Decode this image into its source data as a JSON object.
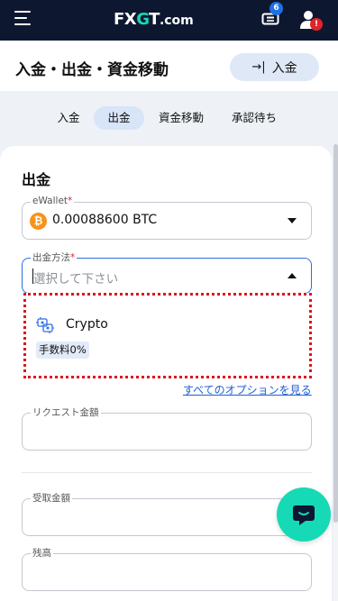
{
  "header": {
    "logo_text_a": "FX",
    "logo_text_g": "G",
    "logo_text_t": "T",
    "logo_text_dom": ".com",
    "promo_badge": "6",
    "user_badge": "!"
  },
  "page": {
    "title": "入金・出金・資金移動",
    "deposit_button": "入金",
    "deposit_icon": "login-arrow-icon"
  },
  "tabs": [
    {
      "label": "入金",
      "active": false
    },
    {
      "label": "出金",
      "active": true
    },
    {
      "label": "資金移動",
      "active": false
    },
    {
      "label": "承認待ち",
      "active": false
    }
  ],
  "form": {
    "section_title": "出金",
    "ewallet": {
      "label": "eWallet",
      "required_mark": "*",
      "value": "0.00088600 BTC",
      "currency_icon": "bitcoin-icon"
    },
    "method": {
      "label": "出金方法",
      "required_mark": "*",
      "placeholder": "選択して下さい"
    },
    "method_options": [
      {
        "label": "Crypto",
        "fee": "手数料0%",
        "icon": "crypto-icon"
      }
    ],
    "all_options_link": "すべてのオプションを見る",
    "request_amount_label": "リクエスト金額",
    "received_amount_label": "受取金額",
    "balance_label": "残高"
  },
  "colors": {
    "nav_bg": "#0d1830",
    "accent_teal": "#16d9b5",
    "accent_blue": "#2b6fe6",
    "highlight_red": "#e0141a"
  }
}
